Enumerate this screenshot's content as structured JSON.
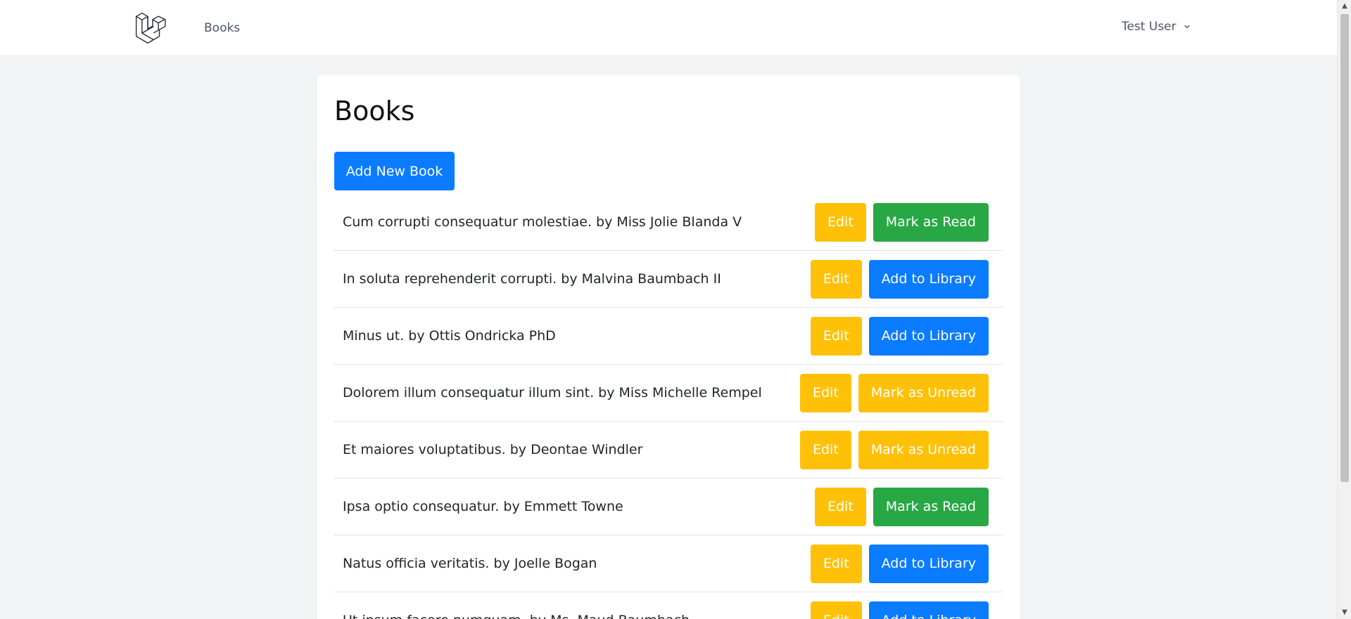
{
  "nav": {
    "books_link": "Books",
    "user_name": "Test User"
  },
  "main": {
    "title": "Books",
    "add_button": "Add New Book",
    "books": [
      {
        "text": "Cum corrupti consequatur molestiae. by Miss Jolie Blanda V",
        "edit": "Edit",
        "action": "Mark as Read",
        "action_style": "success"
      },
      {
        "text": "In soluta reprehenderit corrupti. by Malvina Baumbach II",
        "edit": "Edit",
        "action": "Add to Library",
        "action_style": "primary"
      },
      {
        "text": "Minus ut. by Ottis Ondricka PhD",
        "edit": "Edit",
        "action": "Add to Library",
        "action_style": "primary"
      },
      {
        "text": "Dolorem illum consequatur illum sint. by Miss Michelle Rempel",
        "edit": "Edit",
        "action": "Mark as Unread",
        "action_style": "warning"
      },
      {
        "text": "Et maiores voluptatibus. by Deontae Windler",
        "edit": "Edit",
        "action": "Mark as Unread",
        "action_style": "warning"
      },
      {
        "text": "Ipsa optio consequatur. by Emmett Towne",
        "edit": "Edit",
        "action": "Mark as Read",
        "action_style": "success"
      },
      {
        "text": "Natus officia veritatis. by Joelle Bogan",
        "edit": "Edit",
        "action": "Add to Library",
        "action_style": "primary"
      },
      {
        "text": "Ut ipsum facere numquam. by Ms. Maud Baumbach",
        "edit": "Edit",
        "action": "Add to Library",
        "action_style": "primary"
      }
    ]
  },
  "colors": {
    "primary": "#0b7bff",
    "warning": "#ffc107",
    "success": "#28a745"
  },
  "icons": {
    "logo": "laravel-logo-icon",
    "user_menu": "chevron-down-icon"
  }
}
